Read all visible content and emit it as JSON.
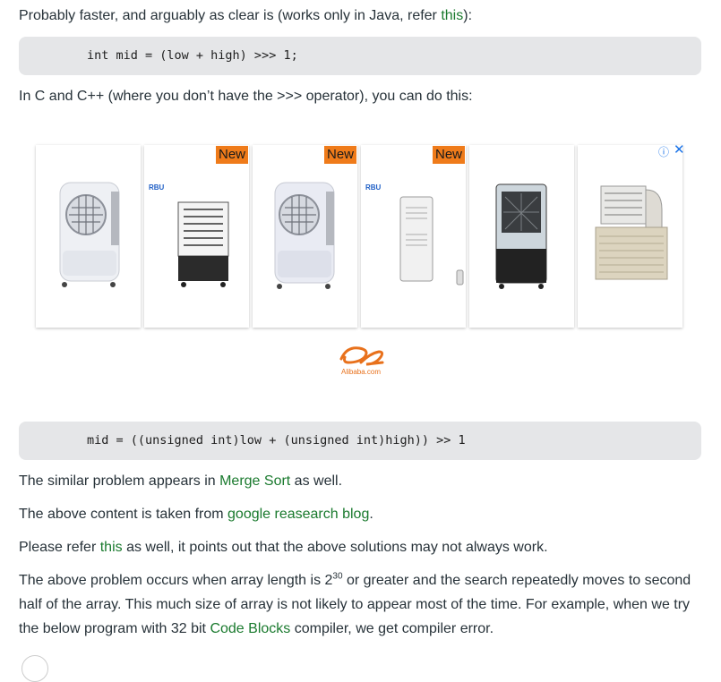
{
  "para1": {
    "text": "Probably faster, and arguably as clear is (works only in Java, refer ",
    "link": "this",
    "end": "):"
  },
  "code1": "int mid = (low + high) >>> 1;",
  "para2": "In C and C++ (where you don’t have the >>> operator), you can do this:",
  "ad": {
    "new_badge": "New",
    "brand_tag": "RBU",
    "logo_text": "Alibaba.com",
    "info_icon": "info-icon",
    "close_icon": "close-icon"
  },
  "code2": "mid = ((unsigned int)low + (unsigned int)high)) >> 1",
  "para3": {
    "pre": "The similar problem appears in ",
    "link": "Merge Sort",
    "post": " as well."
  },
  "para4": {
    "pre": "The above content is taken from ",
    "link": "google reasearch blog",
    "post": "."
  },
  "para5": {
    "pre": "Please refer ",
    "link": "this",
    "post": " as well, it points out that the above solutions may not always work."
  },
  "para6": {
    "pre": "The above problem occurs when array length is 2",
    "sup": "30",
    "mid": " or greater and the search repeatedly moves to second half of the array. This much size of array is not likely to appear most of the time. For example, when we try the below program with 32 bit ",
    "link": "Code Blocks",
    "post": " compiler, we get compiler error."
  }
}
